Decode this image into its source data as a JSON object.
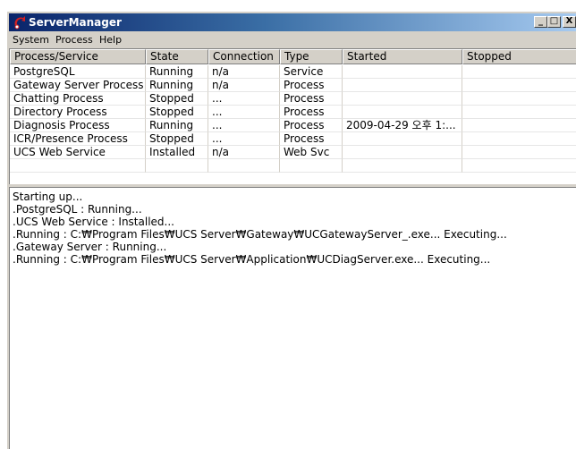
{
  "window": {
    "title": "ServerManager",
    "minimize_glyph": "_",
    "maximize_glyph": "□",
    "close_glyph": "X"
  },
  "menu": [
    "System",
    "Process",
    "Help"
  ],
  "table": {
    "columns": [
      "Process/Service",
      "State",
      "Connection",
      "Type",
      "Started",
      "Stopped"
    ],
    "rows": [
      [
        "PostgreSQL",
        "Running",
        "n/a",
        "Service",
        "",
        ""
      ],
      [
        "Gateway Server Process",
        "Running",
        "n/a",
        "Process",
        "",
        ""
      ],
      [
        "Chatting Process",
        "Stopped",
        "...",
        "Process",
        "",
        ""
      ],
      [
        "Directory Process",
        "Stopped",
        "...",
        "Process",
        "",
        ""
      ],
      [
        "Diagnosis Process",
        "Running",
        "...",
        "Process",
        "2009-04-29 오후 1:...",
        ""
      ],
      [
        "ICR/Presence Process",
        "Stopped",
        "...",
        "Process",
        "",
        ""
      ],
      [
        "UCS Web Service",
        "Installed",
        "n/a",
        "Web Svc",
        "",
        ""
      ]
    ]
  },
  "log": [
    "Starting up...",
    ".PostgreSQL : Running...",
    ".UCS Web Service : Installed...",
    ".Running : C:₩Program Files₩UCS Server₩Gateway₩UCGatewayServer_.exe... Executing...",
    ".Gateway Server : Running...",
    ".Running : C:₩Program Files₩UCS Server₩Application₩UCDiagServer.exe... Executing..."
  ],
  "colors": {
    "titlebar_start": "#0a246a",
    "titlebar_end": "#a6caf0",
    "face": "#d4d0c8",
    "icon_red": "#d42020"
  }
}
